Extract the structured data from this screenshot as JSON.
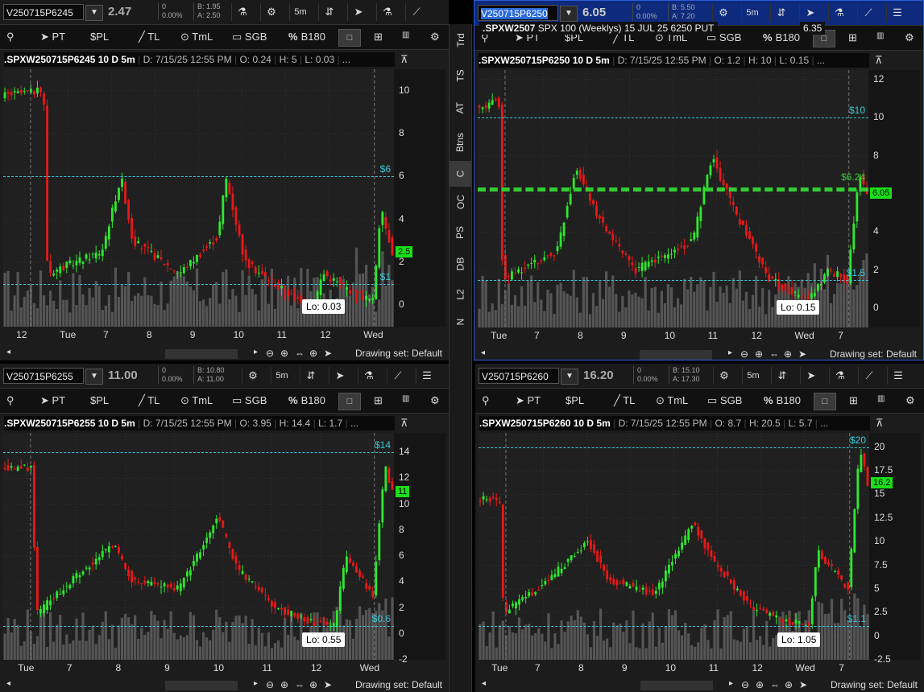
{
  "panes": [
    {
      "symbol": "V250715P6245",
      "price": "2.47",
      "chg_top": "0",
      "chg_pct": "0.00%",
      "bid": "B: 1.95",
      "ask": "A: 2.50",
      "interval": "5m",
      "active": false,
      "header": {
        "sym": ".SPXW250715P6245 10 D 5m",
        "date": "D: 7/15/25 12:55 PM",
        "o": "O: 0.24",
        "h": "H: 5",
        "l": "L: 0.03",
        "more": "..."
      },
      "yticks": [
        "10",
        "8",
        "6",
        "4",
        "2",
        "0"
      ],
      "yvals": [
        10,
        8,
        6,
        4,
        2,
        0
      ],
      "ymin": -1,
      "ymax": 11,
      "xlabels": [
        "12",
        "Tue",
        "7",
        "8",
        "9",
        "10",
        "11",
        "12",
        "Wed"
      ],
      "hlines": [
        {
          "label": "$6",
          "value": 6
        },
        {
          "label": "$1",
          "value": 1
        }
      ],
      "price_tag": "2.5",
      "price_tag_value": 2.5,
      "lo": "Lo: 0.03",
      "drawing_set": "Drawing set: Default"
    },
    {
      "symbol": "V250715P6250",
      "price": "6.05",
      "chg_top": "0",
      "chg_pct": "0.00%",
      "bid": "B: 5.50",
      "ask": "A: 7.20",
      "interval": "5m",
      "active": true,
      "header": {
        "sym": ".SPXW250715P6250 10 D 5m",
        "date": "D: 7/15/25 12:55 PM",
        "o": "O: 1.2",
        "h": "H: 10",
        "l": "L: 0.15",
        "more": "..."
      },
      "yticks": [
        "12",
        "10",
        "8",
        "6",
        "4",
        "2",
        "0"
      ],
      "yvals": [
        12,
        10,
        8,
        6,
        4,
        2,
        0
      ],
      "ymin": -1,
      "ymax": 12.5,
      "xlabels": [
        "Tue",
        "7",
        "8",
        "9",
        "10",
        "11",
        "12",
        "Wed",
        "7"
      ],
      "hlines": [
        {
          "label": "$10",
          "value": 10
        },
        {
          "label": "$1.5",
          "value": 1.5
        }
      ],
      "thick_line": {
        "label": "$6.24",
        "value": 6.24
      },
      "price_tag": "6.05",
      "price_tag_value": 6.05,
      "lo": "Lo: 0.15",
      "drawing_set": "Drawing set: Default",
      "tooltip": "SPX 100 (Weeklys) 15 JUL 25 6250 PUT",
      "tooltip_sym": ".SPXW2507",
      "tooltip_val": "6.35"
    },
    {
      "symbol": "V250715P6255",
      "price": "11.00",
      "chg_top": "0",
      "chg_pct": "0.00%",
      "bid": "B: 10.80",
      "ask": "A: 11.00",
      "interval": "5m",
      "active": false,
      "header": {
        "sym": ".SPXW250715P6255 10 D 5m",
        "date": "D: 7/15/25 12:55 PM",
        "o": "O: 3.95",
        "h": "H: 14.4",
        "l": "L: 1.7",
        "more": "..."
      },
      "yticks": [
        "14",
        "12",
        "10",
        "8",
        "6",
        "4",
        "2",
        "0",
        "-2"
      ],
      "yvals": [
        14,
        12,
        10,
        8,
        6,
        4,
        2,
        0,
        -2
      ],
      "ymin": -2,
      "ymax": 15.5,
      "xlabels": [
        "Tue",
        "7",
        "8",
        "9",
        "10",
        "11",
        "12",
        "Wed"
      ],
      "hlines": [
        {
          "label": "$14",
          "value": 14
        },
        {
          "label": "$0.6",
          "value": 0.6
        }
      ],
      "price_tag": "11",
      "price_tag_value": 11,
      "lo": "Lo: 0.55",
      "drawing_set": "Drawing set: Default"
    },
    {
      "symbol": "V250715P6260",
      "price": "16.20",
      "chg_top": "0",
      "chg_pct": "0.00%",
      "bid": "B: 15.10",
      "ask": "A: 17.30",
      "interval": "5m",
      "active": false,
      "header": {
        "sym": ".SPXW250715P6260 10 D 5m",
        "date": "D: 7/15/25 12:55 PM",
        "o": "O: 8.7",
        "h": "H: 20.5",
        "l": "L: 5.7",
        "more": "..."
      },
      "yticks": [
        "20",
        "17.5",
        "15",
        "12.5",
        "10",
        "7.5",
        "5",
        "2.5",
        "0",
        "-2.5"
      ],
      "yvals": [
        20,
        17.5,
        15,
        12.5,
        10,
        7.5,
        5,
        2.5,
        0,
        -2.5
      ],
      "ymin": -2.5,
      "ymax": 21.5,
      "xlabels": [
        "Tue",
        "7",
        "8",
        "9",
        "10",
        "11",
        "12",
        "Wed",
        "7"
      ],
      "hlines": [
        {
          "label": "$20",
          "value": 20
        },
        {
          "label": "$1.1",
          "value": 1.1
        }
      ],
      "price_tag": "16.2",
      "price_tag_value": 16.2,
      "lo": "Lo: 1.05",
      "drawing_set": "Drawing set: Default"
    }
  ],
  "toolbar": {
    "pin": "📌",
    "pt": "PT",
    "spl": "$PL",
    "tl": "TL",
    "tml": "TmL",
    "sgb": "SGB",
    "b180": "B180",
    "pct": "%"
  },
  "sidebar_tabs": [
    "Trd",
    "TS",
    "AT",
    "Btns",
    "C",
    "OC",
    "PS",
    "DB",
    "L2",
    "N"
  ],
  "colors": {
    "up": "#2ee82e",
    "down": "#e81818",
    "hline": "#3cc8d8",
    "thick": "#33cc33",
    "volume": "#555555"
  }
}
